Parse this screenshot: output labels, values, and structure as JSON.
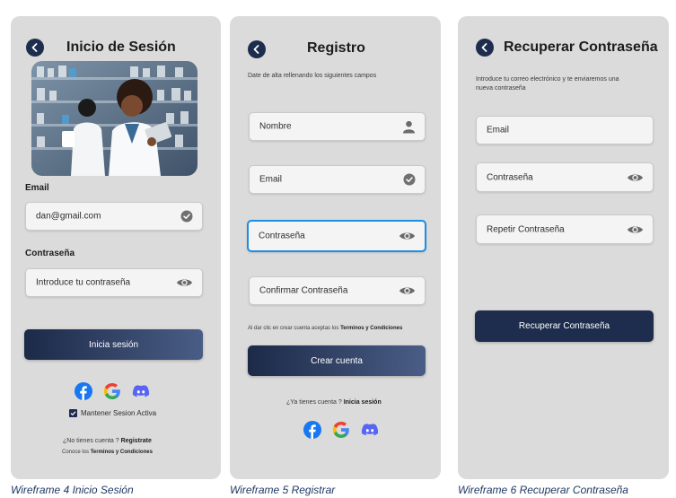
{
  "login": {
    "title": "Inicio de Sesión",
    "email_label": "Email",
    "email_value": "dan@gmail.com",
    "password_label": "Contraseña",
    "password_placeholder": "Introduce tu contraseña",
    "submit": "Inicia sesión",
    "remember": "Mantener Sesion Activa",
    "no_account": "¿No tienes cuenta ?",
    "register_link": "Registrate",
    "terms_prefix": "Conoce los",
    "terms_link": "Terminos y Condiciones",
    "caption": "Wireframe 4 Inicio Sesión"
  },
  "register": {
    "title": "Registro",
    "subtitle": "Date de alta rellenando los siguientes campos",
    "name_field": "Nombre",
    "email_field": "Email",
    "password_field": "Contraseña",
    "confirm_field": "Confirmar Contraseña",
    "terms_prefix": "Al dar clic en crear cuenta aceptas los",
    "terms_link": "Terminos y Condiciones",
    "submit": "Crear cuenta",
    "have_account": "¿Ya tienes cuenta ?",
    "login_link": "Inicia sesión",
    "caption": "Wireframe 5 Registrar"
  },
  "recover": {
    "title": "Recuperar Contraseña",
    "subtitle_line1": "Introduce tu correo electrónico y te enviaremos una",
    "subtitle_line2": "nueva contraseña",
    "email_field": "Email",
    "password_field": "Contraseña",
    "repeat_field": "Repetir Contraseña",
    "submit": "Recuperar Contraseña",
    "caption": "Wireframe 6 Recuperar Contraseña"
  },
  "colors": {
    "primary": "#1e2d4d",
    "focus": "#1a8fe3",
    "caption": "#1f3864",
    "panel": "#dcdbdb"
  },
  "icons": [
    "back-arrow-icon",
    "check-circle-icon",
    "eye-icon",
    "user-icon",
    "facebook-icon",
    "google-icon",
    "discord-icon",
    "checkbox-icon"
  ]
}
